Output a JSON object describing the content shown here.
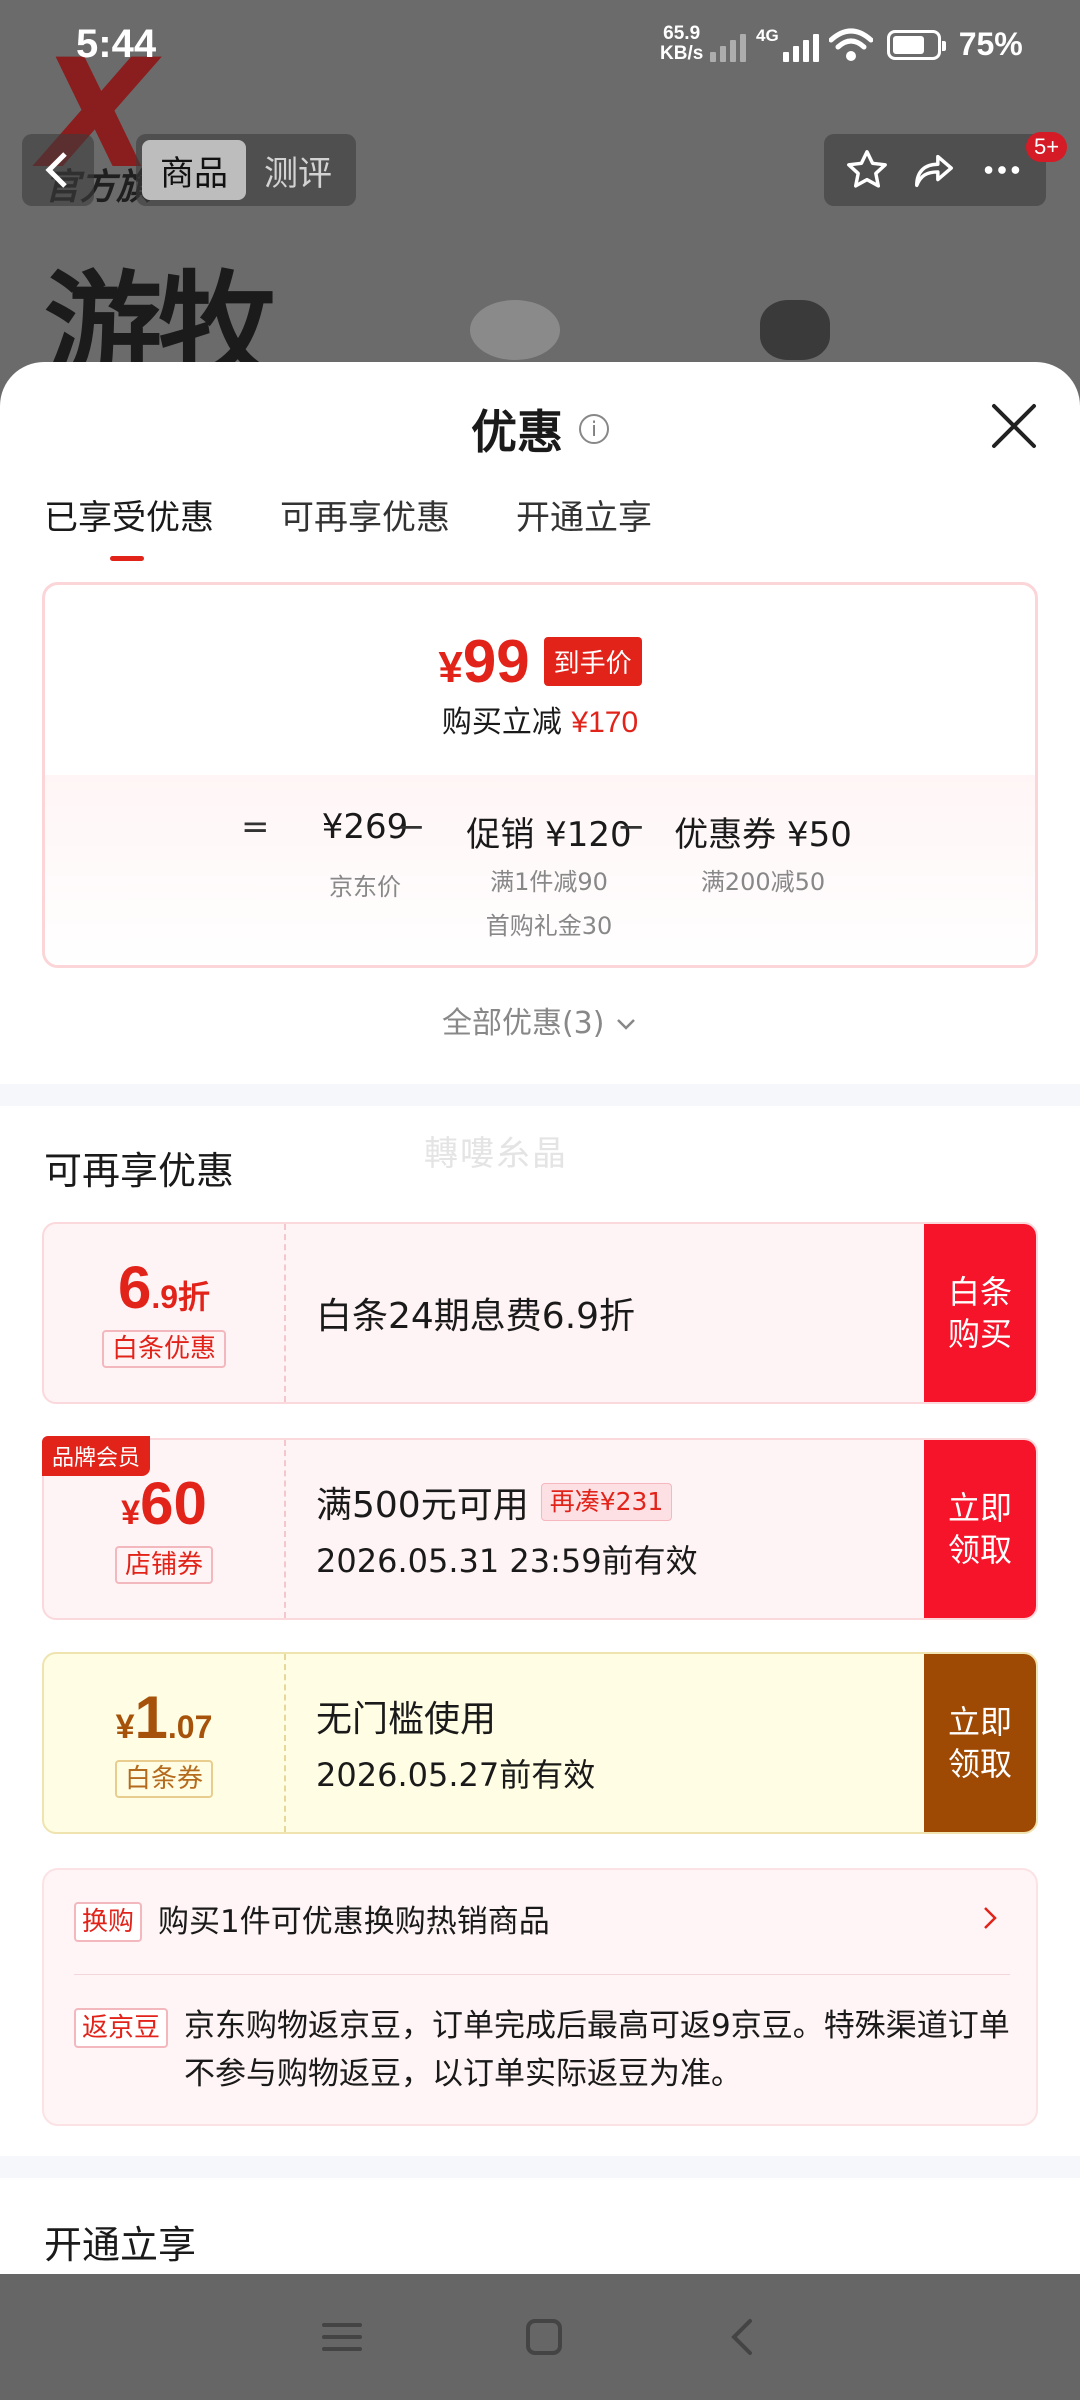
{
  "status": {
    "time": "5:44",
    "speed_value": "65.9",
    "speed_unit": "KB/s",
    "network": "4G",
    "battery_pct": "75%",
    "battery_level": 0.75
  },
  "background": {
    "logo_text": "官方旗",
    "headline": "游牧",
    "tabs": [
      "商品",
      "测评"
    ],
    "badge": "5+"
  },
  "sheet": {
    "title": "优惠",
    "tabs": [
      "已享受优惠",
      "可再享优惠",
      "开通立享"
    ],
    "summary": {
      "final_price_symbol": "¥",
      "final_price": "99",
      "final_badge": "到手价",
      "reduce_label": "购买立减",
      "reduce_amount": "¥170",
      "equals": "=",
      "minus": "−",
      "jd_price": "¥269",
      "jd_price_label": "京东价",
      "promo": "促销 ¥120",
      "promo_detail_1": "满1件减90",
      "promo_detail_2": "首购礼金30",
      "coupon": "优惠券 ¥50",
      "coupon_detail": "满200减50"
    },
    "all_discounts": "全部优惠(3)",
    "watermark": "轉嘍糸晶",
    "more_section_title": "可再享优惠",
    "coupons": [
      {
        "value_big": "6",
        "value_small": ".9折",
        "tag": "白条优惠",
        "title": "白条24期息费6.9折",
        "button": "白条购买"
      },
      {
        "member_badge": "品牌会员",
        "currency": "¥",
        "value_big": "60",
        "tag": "店铺券",
        "title": "满500元可用",
        "extra_tag": "再凑¥231",
        "subtitle": "2026.05.31 23:59前有效",
        "button": "立即领取"
      },
      {
        "currency": "¥",
        "value_big": "1",
        "value_small": ".07",
        "tag": "白条券",
        "title": "无门槛使用",
        "subtitle": "2026.05.27前有效",
        "button": "立即领取"
      }
    ],
    "info": [
      {
        "tag": "换购",
        "text": "购买1件可优惠换购热销商品"
      },
      {
        "tag": "返京豆",
        "text": "京东购物返京豆，订单完成后最高可返9京豆。特殊渠道订单不参与购物返豆，以订单实际返豆为准。"
      }
    ],
    "open_section_title": "开通立享"
  },
  "colors": {
    "accent_red": "#e2231a",
    "button_red": "#f5142a",
    "button_brown": "#9e4a04"
  }
}
